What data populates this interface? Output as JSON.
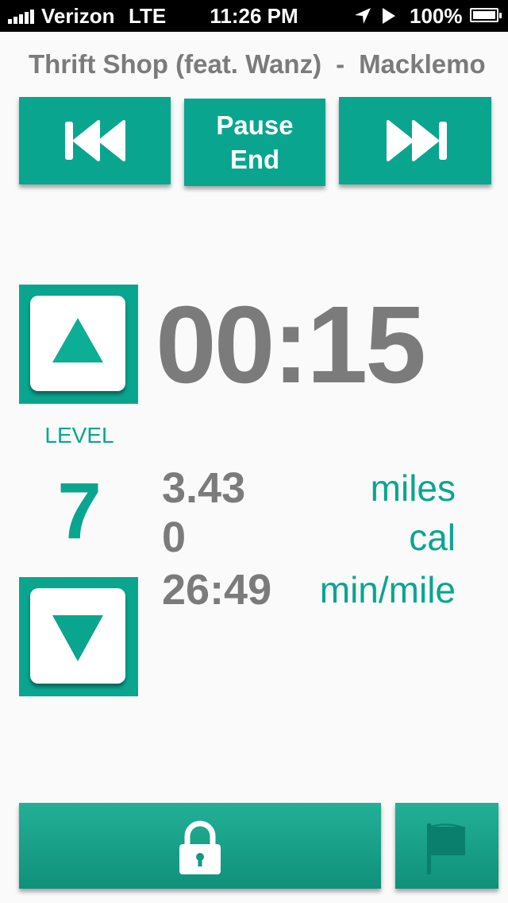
{
  "status_bar": {
    "carrier": "Verizon",
    "network": "LTE",
    "time": "11:26 PM",
    "battery": "100%"
  },
  "now_playing": {
    "title": "Thrift Shop (feat. Wanz)",
    "separator": "-",
    "artist": "Macklemo"
  },
  "controls": {
    "pause_label": "Pause",
    "end_label": "End",
    "prev_icon": "skip-back-icon",
    "next_icon": "skip-forward-icon"
  },
  "workout": {
    "elapsed_time": "00:15",
    "level_label": "LEVEL",
    "level_value": "7",
    "distance_value": "3.43",
    "distance_unit": "miles",
    "calories_value": "0",
    "calories_unit": "cal",
    "pace_value": "26:49",
    "pace_unit": "min/mile"
  },
  "bottom": {
    "lock_icon": "lock-icon",
    "flag_icon": "flag-icon"
  },
  "colors": {
    "accent": "#0aa58f",
    "text_gray": "#7b7b7b",
    "background": "#fafafa"
  }
}
